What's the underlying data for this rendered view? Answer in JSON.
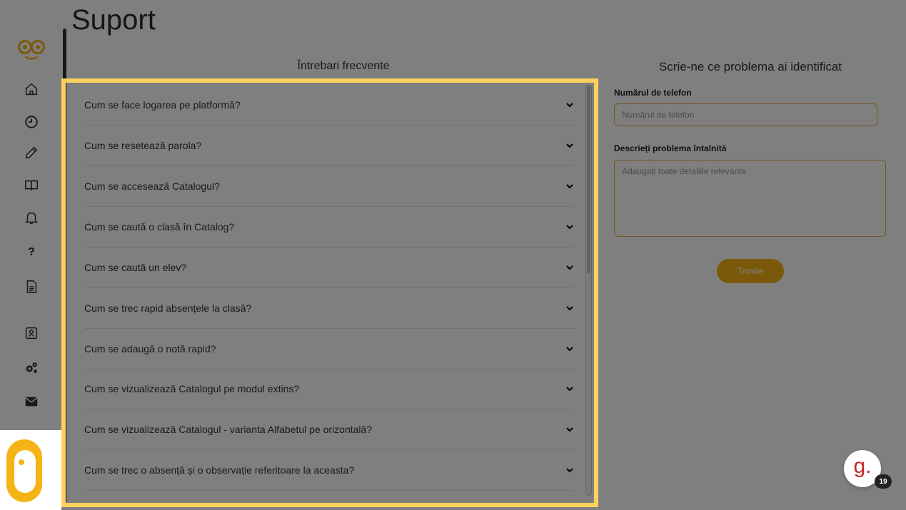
{
  "page": {
    "title": "Suport"
  },
  "faq": {
    "heading": "Întrebari frecvente",
    "items": [
      {
        "question": "Cum se face logarea pe platformă?"
      },
      {
        "question": "Cum se resetează parola?"
      },
      {
        "question": "Cum se accesează Catalogul?"
      },
      {
        "question": "Cum se caută o clasă în Catalog?"
      },
      {
        "question": "Cum se caută un elev?"
      },
      {
        "question": "Cum se trec rapid absențele la clasă?"
      },
      {
        "question": "Cum se adaugă o notă rapid?"
      },
      {
        "question": "Cum se vizualizează Catalogul pe modul extins?"
      },
      {
        "question": "Cum se vizualizează Catalogul - varianta Alfabetul pe orizontală?"
      },
      {
        "question": "Cum se trec o absență și o observație referitoare la aceasta?"
      }
    ]
  },
  "form": {
    "heading": "Scrie-ne ce problema ai identificat",
    "phone_label": "Numărul de telefon",
    "phone_placeholder": "Numărul de telefon",
    "phone_value": "",
    "description_label": "Descrieți problema întalnită",
    "description_placeholder": "Adaugați toate detaliile relevante",
    "description_value": "",
    "submit_label": "Trimite"
  },
  "sidebar": {
    "items": [
      {
        "icon": "home-icon"
      },
      {
        "icon": "clock-icon"
      },
      {
        "icon": "pencil-icon"
      },
      {
        "icon": "book-icon"
      },
      {
        "icon": "bell-icon"
      },
      {
        "icon": "help-icon",
        "text": "?"
      },
      {
        "icon": "document-icon"
      },
      {
        "icon": "contacts-icon"
      },
      {
        "icon": "gears-icon"
      },
      {
        "icon": "mail-icon"
      }
    ]
  },
  "chat": {
    "letter": "g.",
    "badge": "19"
  },
  "colors": {
    "accent": "#f5b415",
    "highlight": "#fad15a",
    "chat": "#c62828"
  }
}
